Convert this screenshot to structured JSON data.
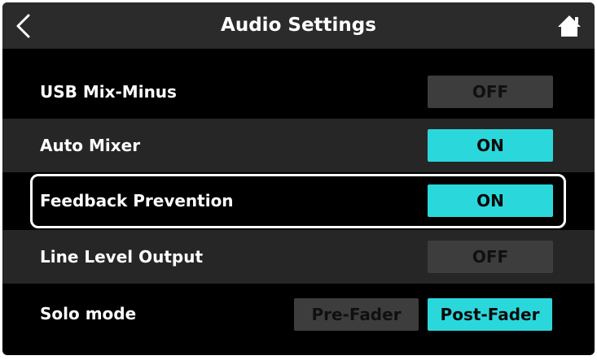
{
  "header": {
    "title": "Audio Settings",
    "back_icon": "chevron-left-icon",
    "home_icon": "home-icon"
  },
  "rows": [
    {
      "label": "USB Mix-Minus",
      "state": "OFF"
    },
    {
      "label": "Auto Mixer",
      "state": "ON"
    },
    {
      "label": "Feedback Prevention",
      "state": "ON",
      "selected": true
    },
    {
      "label": "Line Level Output",
      "state": "OFF"
    }
  ],
  "solo": {
    "label": "Solo mode",
    "options": [
      "Pre-Fader",
      "Post-Fader"
    ],
    "selected": "Post-Fader"
  },
  "colors": {
    "on": "#2ad8dc",
    "off": "#3d3d3d",
    "header": "#2b2b2b",
    "row_alt": "#262626"
  }
}
